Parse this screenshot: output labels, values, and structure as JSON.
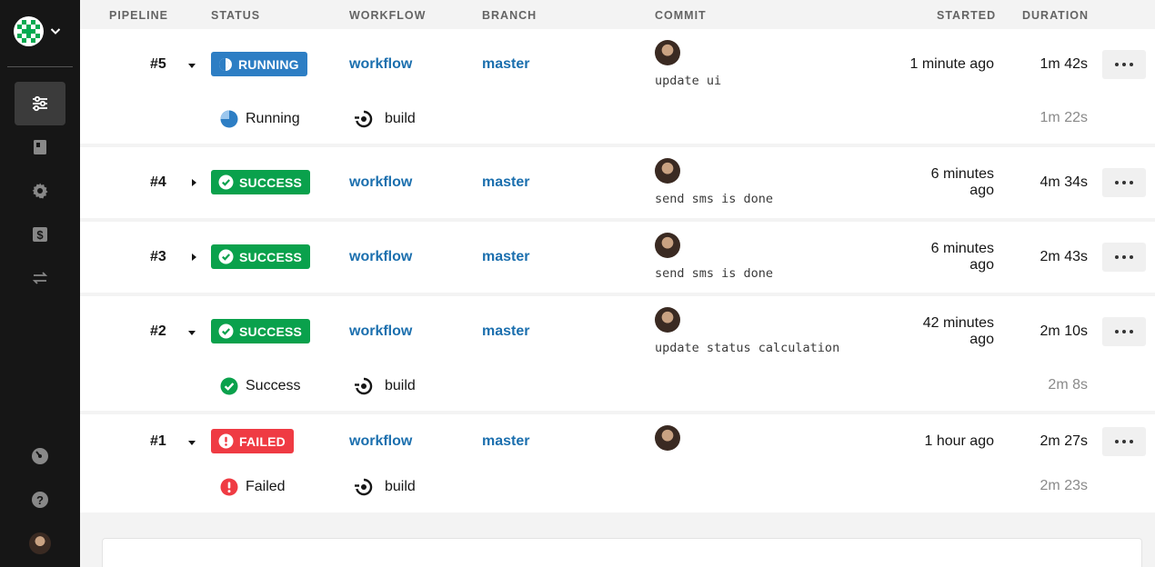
{
  "colors": {
    "running": "#2d7ec4",
    "success": "#0aa14c",
    "failed": "#ef3b43",
    "link": "#1b6fae",
    "sidebar": "#161616"
  },
  "sidebar": {
    "items": [
      {
        "icon": "pipelines-icon",
        "active": true
      },
      {
        "icon": "insights-icon",
        "active": false
      },
      {
        "icon": "settings-icon",
        "active": false
      },
      {
        "icon": "billing-icon",
        "active": false
      },
      {
        "icon": "migrate-icon",
        "active": false
      }
    ],
    "bottom_items": [
      {
        "icon": "dashboard-gauge-icon"
      },
      {
        "icon": "help-icon"
      },
      {
        "icon": "user-avatar"
      }
    ]
  },
  "table": {
    "headers": {
      "pipeline": "PIPELINE",
      "status": "STATUS",
      "workflow": "WORKFLOW",
      "branch": "BRANCH",
      "commit": "COMMIT",
      "started": "STARTED",
      "duration": "DURATION"
    },
    "rows": [
      {
        "number": "#5",
        "expanded": true,
        "status": "RUNNING",
        "workflow": "workflow",
        "branch": "master",
        "commit_message": "update ui",
        "started_line1": "1 minute ago",
        "started_line2": "",
        "duration": "1m 42s",
        "job": {
          "status": "Running",
          "name": "build",
          "duration": "1m 22s"
        }
      },
      {
        "number": "#4",
        "expanded": false,
        "status": "SUCCESS",
        "workflow": "workflow",
        "branch": "master",
        "commit_message": "send sms is done",
        "started_line1": "6 minutes",
        "started_line2": "ago",
        "duration": "4m 34s"
      },
      {
        "number": "#3",
        "expanded": false,
        "status": "SUCCESS",
        "workflow": "workflow",
        "branch": "master",
        "commit_message": "send sms is done",
        "started_line1": "6 minutes",
        "started_line2": "ago",
        "duration": "2m 43s"
      },
      {
        "number": "#2",
        "expanded": true,
        "status": "SUCCESS",
        "workflow": "workflow",
        "branch": "master",
        "commit_message": "update status calculation",
        "started_line1": "42 minutes",
        "started_line2": "ago",
        "duration": "2m 10s",
        "job": {
          "status": "Success",
          "name": "build",
          "duration": "2m 8s"
        }
      },
      {
        "number": "#1",
        "expanded": true,
        "status": "FAILED",
        "workflow": "workflow",
        "branch": "master",
        "commit_message": "",
        "started_line1": "1 hour ago",
        "started_line2": "",
        "duration": "2m 27s",
        "job": {
          "status": "Failed",
          "name": "build",
          "duration": "2m 23s"
        }
      }
    ]
  }
}
